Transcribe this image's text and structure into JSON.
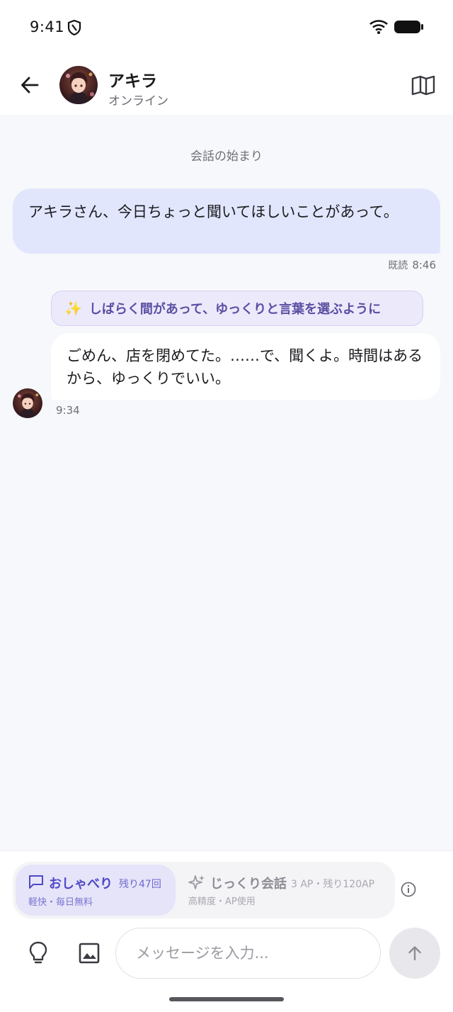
{
  "status_bar": {
    "time": "9:41"
  },
  "header": {
    "contact_name": "アキラ",
    "contact_status": "オンライン"
  },
  "chat": {
    "conversation_start": "会話の始まり",
    "messages": [
      {
        "from": "user",
        "text": "アキラさん、今日ちょっと聞いてほしいことがあって。",
        "read_label": "既読",
        "time": "8:46"
      },
      {
        "from": "bot",
        "action": "しばらく間があって、ゆっくりと言葉を選ぶように",
        "action_emoji": "✨",
        "text": "ごめん、店を閉めてた。……で、聞くよ。時間はあるから、ゆっくりでいい。",
        "time": "9:34"
      }
    ]
  },
  "modes": {
    "chat": {
      "title": "おしゃべり",
      "remaining": "残り47回",
      "subtitle": "軽快・毎日無料",
      "icon": "chat-bubble-icon"
    },
    "deep": {
      "title": "じっくり会話",
      "cost": "3 AP・残り120AP",
      "subtitle": "高精度・AP使用",
      "icon": "sparkle-icon"
    }
  },
  "composer": {
    "placeholder": "メッセージを入力..."
  },
  "colors": {
    "accent": "#4e48c5",
    "user_bubble": "#e1e6fd",
    "action_pill": "#ece9fb",
    "background": "#f7f8fb"
  }
}
